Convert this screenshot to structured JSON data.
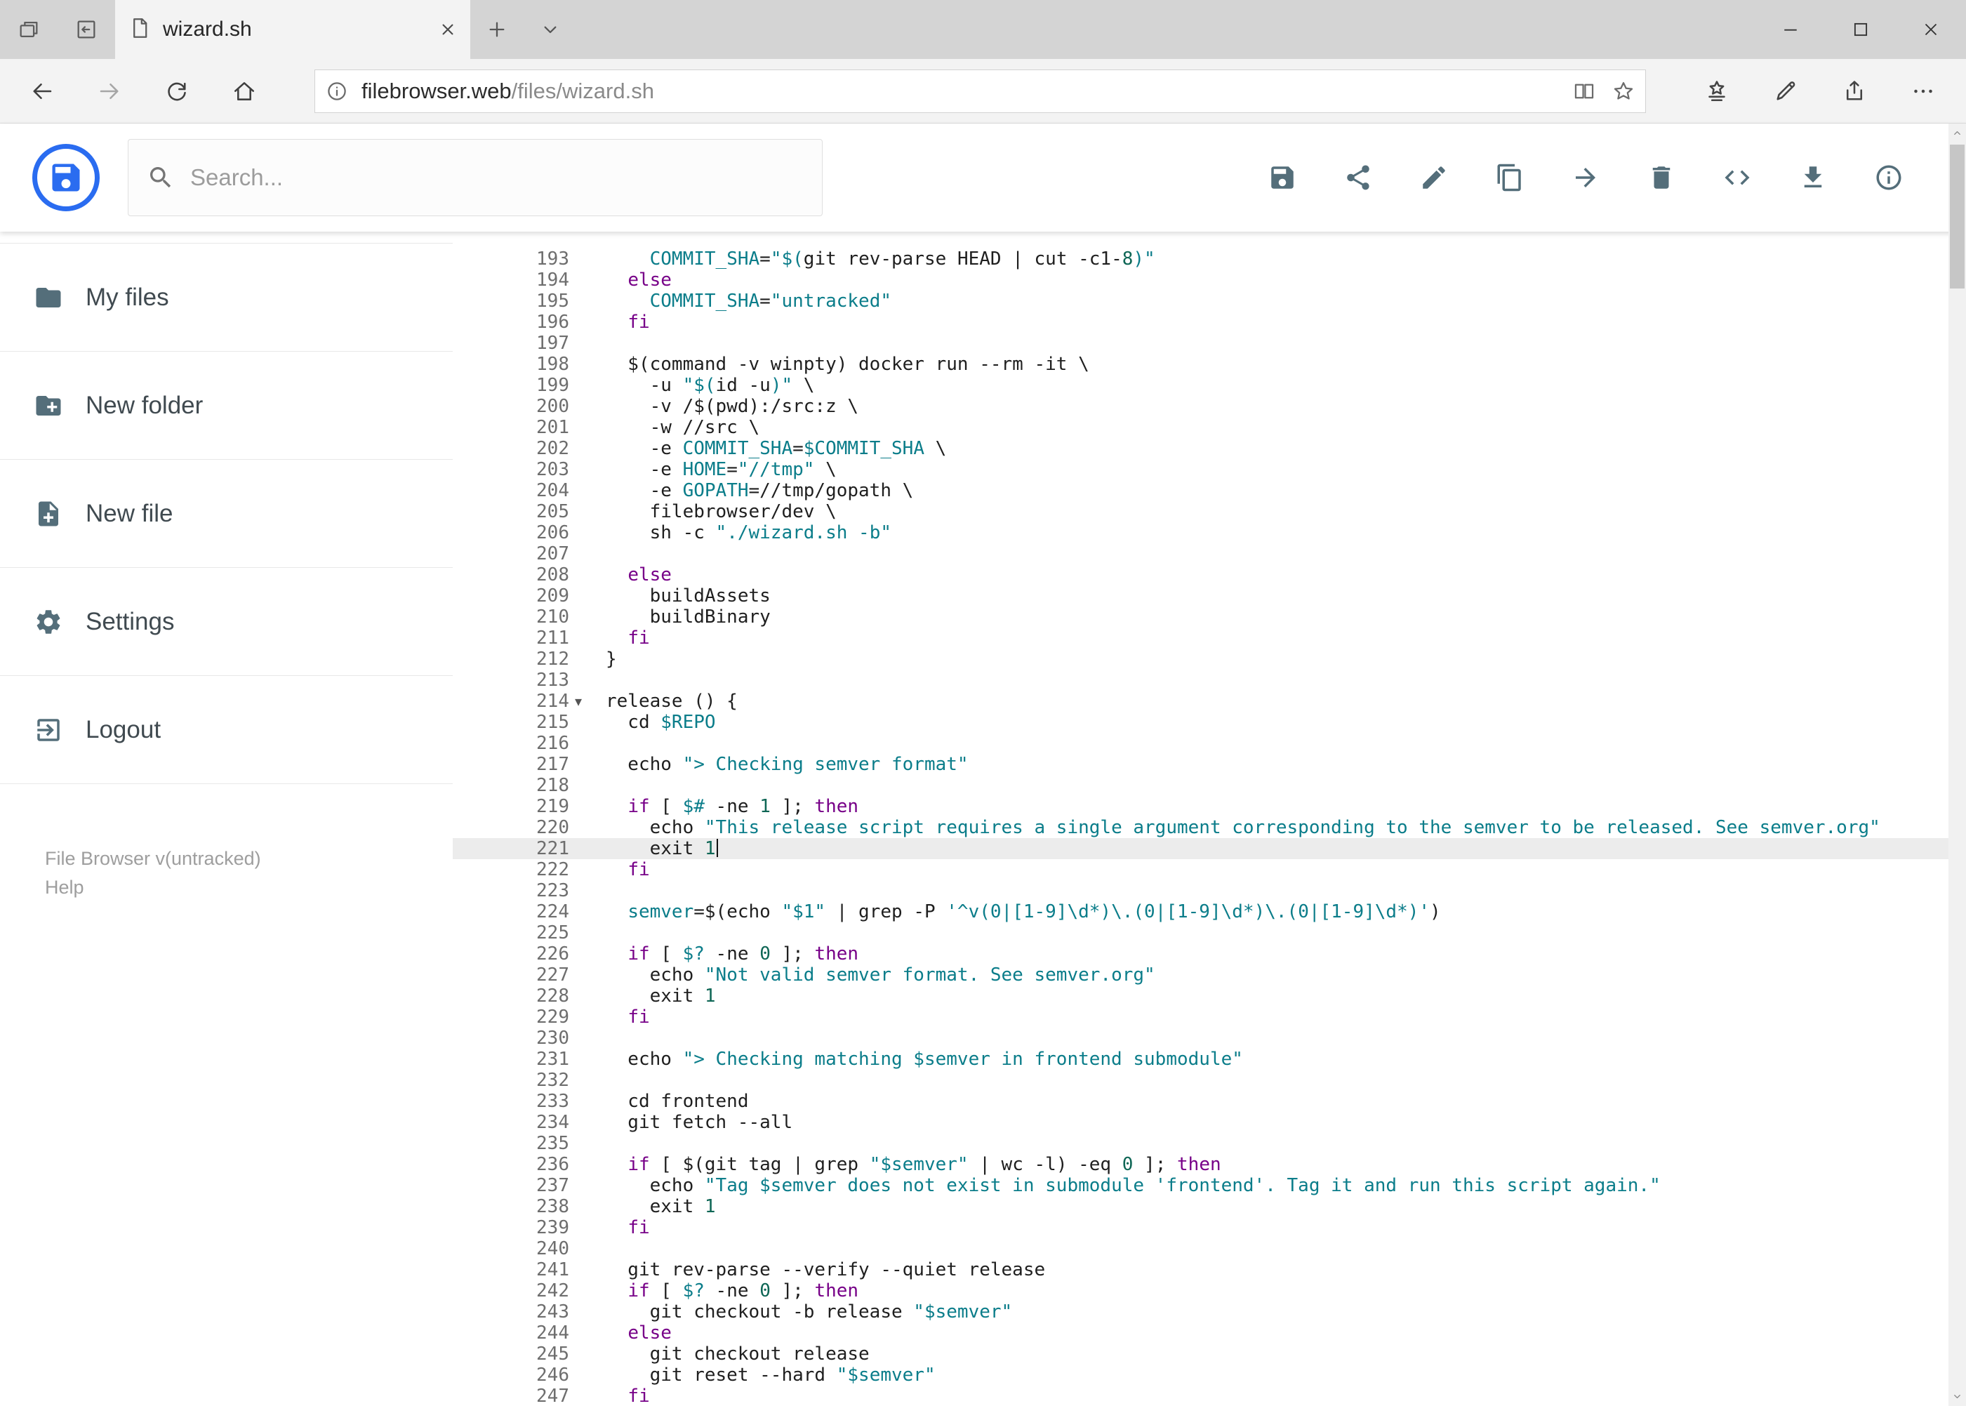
{
  "colors": {
    "accent": "#2a6cf0",
    "toolbar_icon": "#546e7a",
    "keyword": "#770088",
    "string": "#0b7d8a",
    "variable": "#0b7d8a",
    "definition": "#0b7d8a",
    "number": "#0e6655",
    "active_line_bg": "#ececec"
  },
  "browser": {
    "tab_title": "wizard.sh",
    "url_host": "filebrowser.web",
    "url_path": "/files/wizard.sh",
    "window_control_icons": [
      "minimize",
      "maximize",
      "close"
    ],
    "nav_icons": [
      "back",
      "forward",
      "refresh",
      "home"
    ],
    "address_icons": [
      "info",
      "reading-view",
      "favorite-star"
    ],
    "chrome_action_icons": [
      "hub",
      "web-note",
      "share",
      "more"
    ]
  },
  "app": {
    "search_placeholder": "Search...",
    "toolbar": [
      {
        "name": "save-button",
        "icon": "save"
      },
      {
        "name": "share-button",
        "icon": "share"
      },
      {
        "name": "rename-button",
        "icon": "edit"
      },
      {
        "name": "copy-button",
        "icon": "copy"
      },
      {
        "name": "move-button",
        "icon": "move"
      },
      {
        "name": "delete-button",
        "icon": "delete"
      },
      {
        "name": "raw-view-button",
        "icon": "code"
      },
      {
        "name": "download-button",
        "icon": "download"
      },
      {
        "name": "info-button",
        "icon": "info"
      }
    ],
    "sidebar": [
      {
        "name": "sidebar-item-my-files",
        "icon": "folder",
        "label": "My files"
      },
      {
        "name": "sidebar-item-new-folder",
        "icon": "new-folder",
        "label": "New folder"
      },
      {
        "name": "sidebar-item-new-file",
        "icon": "new-file",
        "label": "New file"
      },
      {
        "name": "sidebar-item-settings",
        "icon": "settings",
        "label": "Settings"
      },
      {
        "name": "sidebar-item-logout",
        "icon": "logout",
        "label": "Logout"
      }
    ],
    "footer_version": "File Browser v(untracked)",
    "footer_help": "Help"
  },
  "editor": {
    "language": "shell",
    "active_line": 221,
    "cursor": {
      "line": 221,
      "col": 10
    },
    "fold_marker_line": 214,
    "first_line": 193,
    "last_line": 247,
    "lines": [
      {
        "n": 193,
        "t": "    COMMIT_SHA=\"$(git rev-parse HEAD | cut -c1-8)\""
      },
      {
        "n": 194,
        "t": "  else"
      },
      {
        "n": 195,
        "t": "    COMMIT_SHA=\"untracked\""
      },
      {
        "n": 196,
        "t": "  fi"
      },
      {
        "n": 197,
        "t": ""
      },
      {
        "n": 198,
        "t": "  $(command -v winpty) docker run --rm -it \\"
      },
      {
        "n": 199,
        "t": "    -u \"$(id -u)\" \\"
      },
      {
        "n": 200,
        "t": "    -v /$(pwd):/src:z \\"
      },
      {
        "n": 201,
        "t": "    -w //src \\"
      },
      {
        "n": 202,
        "t": "    -e COMMIT_SHA=$COMMIT_SHA \\"
      },
      {
        "n": 203,
        "t": "    -e HOME=\"//tmp\" \\"
      },
      {
        "n": 204,
        "t": "    -e GOPATH=//tmp/gopath \\"
      },
      {
        "n": 205,
        "t": "    filebrowser/dev \\"
      },
      {
        "n": 206,
        "t": "    sh -c \"./wizard.sh -b\""
      },
      {
        "n": 207,
        "t": ""
      },
      {
        "n": 208,
        "t": "  else"
      },
      {
        "n": 209,
        "t": "    buildAssets"
      },
      {
        "n": 210,
        "t": "    buildBinary"
      },
      {
        "n": 211,
        "t": "  fi"
      },
      {
        "n": 212,
        "t": "}"
      },
      {
        "n": 213,
        "t": ""
      },
      {
        "n": 214,
        "t": "release () {"
      },
      {
        "n": 215,
        "t": "  cd $REPO"
      },
      {
        "n": 216,
        "t": ""
      },
      {
        "n": 217,
        "t": "  echo \"> Checking semver format\""
      },
      {
        "n": 218,
        "t": ""
      },
      {
        "n": 219,
        "t": "  if [ $# -ne 1 ]; then"
      },
      {
        "n": 220,
        "t": "    echo \"This release script requires a single argument corresponding to the semver to be released. See semver.org\""
      },
      {
        "n": 221,
        "t": "    exit 1"
      },
      {
        "n": 222,
        "t": "  fi"
      },
      {
        "n": 223,
        "t": ""
      },
      {
        "n": 224,
        "t": "  semver=$(echo \"$1\" | grep -P '^v(0|[1-9]\\d*)\\.(0|[1-9]\\d*)\\.(0|[1-9]\\d*)')"
      },
      {
        "n": 225,
        "t": ""
      },
      {
        "n": 226,
        "t": "  if [ $? -ne 0 ]; then"
      },
      {
        "n": 227,
        "t": "    echo \"Not valid semver format. See semver.org\""
      },
      {
        "n": 228,
        "t": "    exit 1"
      },
      {
        "n": 229,
        "t": "  fi"
      },
      {
        "n": 230,
        "t": ""
      },
      {
        "n": 231,
        "t": "  echo \"> Checking matching $semver in frontend submodule\""
      },
      {
        "n": 232,
        "t": ""
      },
      {
        "n": 233,
        "t": "  cd frontend"
      },
      {
        "n": 234,
        "t": "  git fetch --all"
      },
      {
        "n": 235,
        "t": ""
      },
      {
        "n": 236,
        "t": "  if [ $(git tag | grep \"$semver\" | wc -l) -eq 0 ]; then"
      },
      {
        "n": 237,
        "t": "    echo \"Tag $semver does not exist in submodule 'frontend'. Tag it and run this script again.\""
      },
      {
        "n": 238,
        "t": "    exit 1"
      },
      {
        "n": 239,
        "t": "  fi"
      },
      {
        "n": 240,
        "t": ""
      },
      {
        "n": 241,
        "t": "  git rev-parse --verify --quiet release"
      },
      {
        "n": 242,
        "t": "  if [ $? -ne 0 ]; then"
      },
      {
        "n": 243,
        "t": "    git checkout -b release \"$semver\""
      },
      {
        "n": 244,
        "t": "  else"
      },
      {
        "n": 245,
        "t": "    git checkout release"
      },
      {
        "n": 246,
        "t": "    git reset --hard \"$semver\""
      },
      {
        "n": 247,
        "t": "  fi"
      }
    ]
  }
}
